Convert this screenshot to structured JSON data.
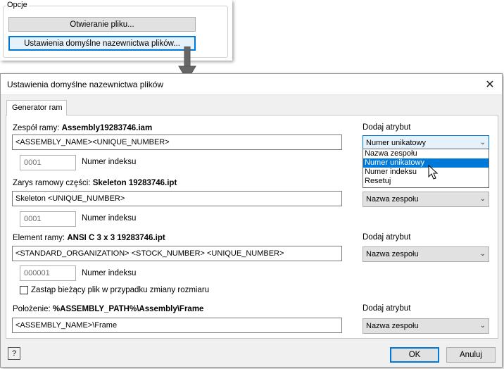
{
  "options_group": {
    "legend": "Opcje",
    "open_file_button": "Otwieranie pliku...",
    "naming_defaults_button": "Ustawienia domyślne nazewnictwa plików..."
  },
  "dialog": {
    "title": "Ustawienia domyślne nazewnictwa plików",
    "close_glyph": "✕",
    "tab_label": "Generator ram",
    "add_attribute_label": "Dodaj atrybut",
    "index_number_label": "Numer indeksu",
    "frame_assembly": {
      "label": "Zespół ramy:",
      "file": "Assembly19283746.iam",
      "pattern": "<ASSEMBLY_NAME><UNIQUE_NUMBER>",
      "index_value": "0001",
      "combo_value": "Numer unikatowy",
      "dropdown_options": [
        "Nazwa zespołu",
        "Numer unikatowy",
        "Numer indeksu",
        "Resetuj"
      ],
      "dropdown_selected": "Numer unikatowy"
    },
    "skeleton": {
      "label": "Zarys ramowy części:",
      "file": "Skeleton 19283746.ipt",
      "pattern": "Skeleton <UNIQUE_NUMBER>",
      "index_value": "0001",
      "combo_value": "Nazwa zespołu"
    },
    "frame_member": {
      "label": "Element ramy:",
      "file": "ANSI C 3 x 3 19283746.ipt",
      "pattern": "<STANDARD_ORGANIZATION> <STOCK_NUMBER> <UNIQUE_NUMBER>",
      "index_value": "000001",
      "combo_value": "Nazwa zespołu",
      "replace_checkbox_label": "Zastąp bieżący plik w przypadku zmiany rozmiaru",
      "replace_checked": false
    },
    "location": {
      "label": "Położenie:",
      "path": "%ASSEMBLY_PATH%\\Assembly\\Frame",
      "pattern": "<ASSEMBLY_NAME>\\Frame",
      "combo_value": "Nazwa zespołu"
    },
    "help_glyph": "?",
    "ok_label": "OK",
    "cancel_label": "Anuluj"
  },
  "icons": [
    "chevron-down-icon",
    "mouse-cursor-icon",
    "down-arrow-icon",
    "help-icon",
    "close-icon"
  ]
}
